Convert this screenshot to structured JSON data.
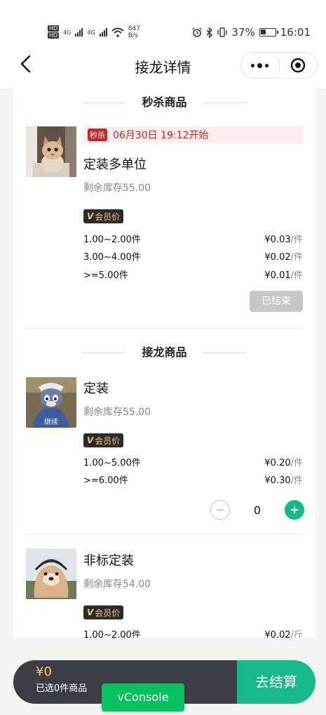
{
  "status_bar": {
    "hd1": "HD",
    "hd2": "HD",
    "net1": "4G",
    "net2": "4G",
    "speed_value": "847",
    "speed_unit": "B/s",
    "battery": "37%",
    "time": "16:01"
  },
  "nav": {
    "title": "接龙详情"
  },
  "flash_section": {
    "title": "秒杀商品",
    "item": {
      "tag": "秒杀",
      "start_time": "06月30日 19:12开始",
      "name": "定装多单位",
      "stock": "剩余库存55.00",
      "vip_label": "会员价",
      "tiers": [
        {
          "range": "1.00~2.00件",
          "price": "¥0.03",
          "unit": "/件"
        },
        {
          "range": "3.00~4.00件",
          "price": "¥0.02",
          "unit": "/件"
        },
        {
          "range": ">=5.00件",
          "price": "¥0.01",
          "unit": "/件"
        }
      ],
      "button": "已结束"
    }
  },
  "group_section": {
    "title": "接龙商品",
    "items": [
      {
        "name": "定装",
        "stock": "剩余库存55.00",
        "vip_label": "会员价",
        "image_caption": "继续",
        "tiers": [
          {
            "range": "1.00~5.00件",
            "price": "¥0.20",
            "unit": "/件"
          },
          {
            "range": ">=6.00件",
            "price": "¥0.30",
            "unit": "/件"
          }
        ],
        "quantity": "0"
      },
      {
        "name": "非标定装",
        "stock": "剩余库存54.00",
        "vip_label": "会员价",
        "tiers": [
          {
            "range": "1.00~2.00件",
            "price": "¥0.02",
            "unit": "/斤"
          }
        ]
      }
    ]
  },
  "bottom_bar": {
    "total": "¥0",
    "selected": "已选0件商品",
    "checkout": "去结算"
  },
  "vconsole": "vConsole",
  "colors": {
    "accent": "#17b98b",
    "flash_red": "#c9242b",
    "vip_gold": "#f0c96e",
    "cart_dark": "#3d3e45"
  }
}
